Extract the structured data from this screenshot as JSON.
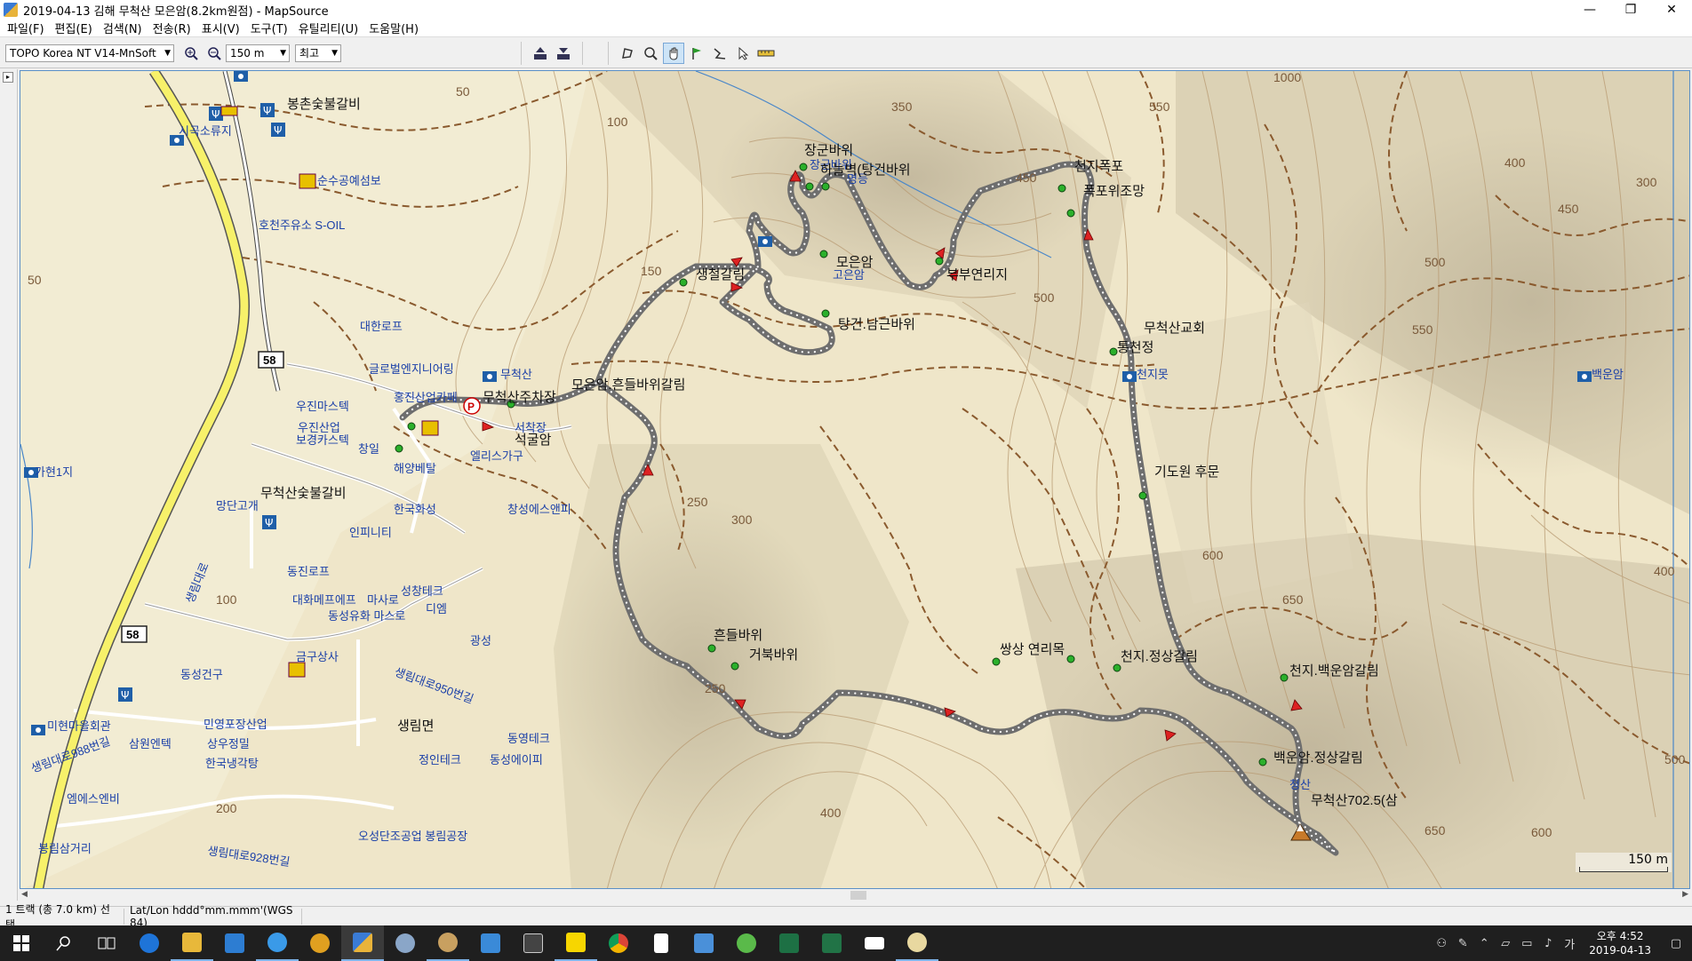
{
  "window": {
    "title": "2019-04-13 김해 무척산 모은암(8.2km원점) - MapSource",
    "controls": {
      "minimize": "—",
      "maximize": "❐",
      "close": "✕"
    }
  },
  "menu": [
    "파일(F)",
    "편집(E)",
    "검색(N)",
    "전송(R)",
    "표시(V)",
    "도구(T)",
    "유틸리티(U)",
    "도움말(H)"
  ],
  "toolbar": {
    "map_product": "TOPO Korea NT V14-MnSoft",
    "zoom_level": "150 m",
    "detail": "최고"
  },
  "map": {
    "scale_label": "150 m",
    "labels_blue": [
      "시곡소류지",
      "순수공예섬보",
      "호천주유소 S-OIL",
      "대한로프",
      "글로벌엔지니어링",
      "무척산",
      "홍진산업카페",
      "우진마스텍",
      "우진산업",
      "보경카스텍",
      "창일",
      "해양베탈",
      "한국화성",
      "창성에스앤피",
      "인피니티",
      "동진로프",
      "대화메프에프",
      "성창테크",
      "동성유화 마스로",
      "디엠",
      "광성",
      "동성건구",
      "금구상사",
      "민영포장산업",
      "상우정밀",
      "한국냉각탕",
      "삼원엔텍",
      "미현마을회관",
      "정인테크",
      "동영테크",
      "동성에이피",
      "엠에스엔비",
      "오성단조공업 봉림공장",
      "봉림삼거리",
      "가현1지",
      "천지못",
      "백운암",
      "장군바위",
      "명등",
      "고은암",
      "청산",
      "엘리스가구",
      "망단고개",
      "서착장",
      "생림대로",
      "생림대로988번길",
      "생림대로950번길",
      "생림대로928번길",
      "마사로"
    ],
    "labels_black": [
      "봉촌숯불갈비",
      "무척산숯불갈비",
      "무척산주차장",
      "모은암.흔들바위갈림",
      "석굴암",
      "생철갈림",
      "장군바위",
      "하늘벽(탕건바위",
      "모은암",
      "탕건.남근바위",
      "부부연리지",
      "천지폭포",
      "폭포위조망",
      "무척산교회",
      "통천정",
      "기도원 후문",
      "흔들바위",
      "거북바위",
      "쌍상 연리목",
      "천지.정상갈림",
      "천지.백운암갈림",
      "백운암.정상갈림",
      "무척산702.5(삼",
      "생림면"
    ],
    "contours": [
      "50",
      "100",
      "150",
      "200",
      "250",
      "300",
      "350",
      "400",
      "450",
      "500",
      "550",
      "600",
      "650",
      "300",
      "400",
      "450",
      "500",
      "550",
      "600",
      "650",
      "250",
      "100",
      "50",
      "1000",
      "400",
      "500"
    ],
    "road_numbers": [
      "58",
      "58"
    ]
  },
  "statusbar": {
    "selection": "1 트랙 (총 7.0 km) 선택",
    "coords": "Lat/Lon hddd°mm.mmm'(WGS 84)"
  },
  "taskbar": {
    "apps": [
      "start",
      "search",
      "task-view",
      "edge",
      "explorer",
      "store",
      "ie",
      "app1",
      "mapsource",
      "app2",
      "app3",
      "app4",
      "calculator",
      "kakaotalk",
      "chrome",
      "notepad",
      "app5",
      "app6",
      "app7",
      "excel",
      "mail",
      "app8"
    ],
    "clock_time": "오후 4:52",
    "clock_date": "2019-04-13",
    "ime": "가"
  }
}
